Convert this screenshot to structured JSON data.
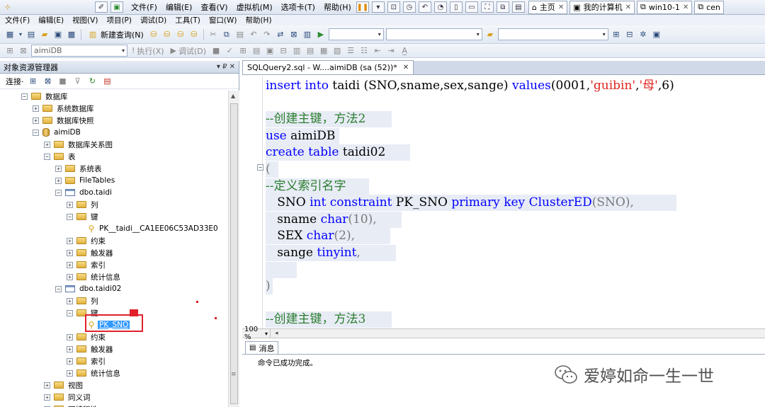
{
  "vm": {
    "menu": [
      "文件(F)",
      "编辑(E)",
      "查看(V)",
      "虚拟机(M)",
      "选项卡(T)",
      "帮助(H)"
    ],
    "tabs": [
      "主页",
      "我的计算机",
      "win10-1",
      "cen"
    ]
  },
  "ssms_menu": [
    "文件(F)",
    "编辑(E)",
    "视图(V)",
    "项目(P)",
    "调试(D)",
    "工具(T)",
    "窗口(W)",
    "帮助(H)"
  ],
  "toolbar1": {
    "new_query": "新建查询(N)"
  },
  "toolbar2": {
    "database": "aimiDB",
    "execute": "执行(X)",
    "debug": "调试(D)"
  },
  "explorer": {
    "title": "对象资源管理器",
    "pin": "▾ ₽ ✕",
    "connect": "连接·",
    "tree": [
      {
        "label": "数据库",
        "expander": "⊟",
        "icon": "folder"
      },
      {
        "label": "系统数据库",
        "expander": "⊞",
        "icon": "folder"
      },
      {
        "label": "数据库快照",
        "expander": "⊞",
        "icon": "folder"
      },
      {
        "label": "aimiDB",
        "expander": "⊟",
        "icon": "database"
      },
      {
        "label": "数据库关系图",
        "expander": "⊞",
        "icon": "folder"
      },
      {
        "label": "表",
        "expander": "⊟",
        "icon": "folder"
      },
      {
        "label": "系统表",
        "expander": "⊞",
        "icon": "folder"
      },
      {
        "label": "FileTables",
        "expander": "⊞",
        "icon": "folder"
      },
      {
        "label": "dbo.taidi",
        "expander": "⊟",
        "icon": "table"
      },
      {
        "label": "列",
        "expander": "⊞",
        "icon": "folder"
      },
      {
        "label": "键",
        "expander": "⊟",
        "icon": "folder"
      },
      {
        "label": "PK__taidi__CA1EE06C53AD33E0",
        "expander": "",
        "icon": "key"
      },
      {
        "label": "约束",
        "expander": "⊞",
        "icon": "folder"
      },
      {
        "label": "触发器",
        "expander": "⊞",
        "icon": "folder"
      },
      {
        "label": "索引",
        "expander": "⊞",
        "icon": "folder"
      },
      {
        "label": "统计信息",
        "expander": "⊞",
        "icon": "folder"
      },
      {
        "label": "dbo.taidi02",
        "expander": "⊟",
        "icon": "table"
      },
      {
        "label": "列",
        "expander": "⊞",
        "icon": "folder"
      },
      {
        "label": "键",
        "expander": "⊟",
        "icon": "folder"
      },
      {
        "label": "PK_SNO",
        "expander": "",
        "icon": "key"
      },
      {
        "label": "约束",
        "expander": "⊞",
        "icon": "folder"
      },
      {
        "label": "触发器",
        "expander": "⊞",
        "icon": "folder"
      },
      {
        "label": "索引",
        "expander": "⊞",
        "icon": "folder"
      },
      {
        "label": "统计信息",
        "expander": "⊞",
        "icon": "folder"
      },
      {
        "label": "视图",
        "expander": "⊞",
        "icon": "folder"
      },
      {
        "label": "同义词",
        "expander": "⊞",
        "icon": "folder"
      },
      {
        "label": "可编程性",
        "expander": "⊞",
        "icon": "folder"
      }
    ]
  },
  "editor": {
    "tab_label": "SQLQuery2.sql - W....aimiDB (sa (52))*",
    "code": [
      [
        [
          "insert into",
          "kw"
        ],
        [
          " taidi (SNO,sname,sex,sange) ",
          ""
        ],
        [
          "values",
          "kw"
        ],
        [
          "(0001,",
          ""
        ],
        [
          "'guibin'",
          "str"
        ],
        [
          ",",
          ""
        ],
        [
          "'母'",
          "str"
        ],
        [
          ",6)",
          ""
        ]
      ],
      [],
      [
        [
          "--创建主键，方法2",
          "cm"
        ]
      ],
      [
        [
          "use",
          "kw"
        ],
        [
          " aimiDB",
          ""
        ]
      ],
      [
        [
          "create table",
          "kw"
        ],
        [
          " taidi02",
          ""
        ]
      ],
      [
        [
          "(",
          "gray"
        ]
      ],
      [
        [
          "--定义索引名字",
          "cm"
        ]
      ],
      [
        [
          "   SNO ",
          ""
        ],
        [
          "int constraint",
          "kw"
        ],
        [
          " PK_SNO ",
          ""
        ],
        [
          "primary key",
          "kw"
        ],
        [
          " ",
          ""
        ],
        [
          "ClusterED",
          "kw"
        ],
        [
          "(SNO),",
          "gray"
        ]
      ],
      [
        [
          "   sname ",
          ""
        ],
        [
          "char",
          "kw"
        ],
        [
          "(10),",
          "gray"
        ]
      ],
      [
        [
          "   SEX ",
          ""
        ],
        [
          "char",
          "kw"
        ],
        [
          "(2),",
          "gray"
        ]
      ],
      [
        [
          "   sange ",
          ""
        ],
        [
          "tinyint",
          "kw"
        ],
        [
          ",",
          "gray"
        ]
      ],
      [
        [
          "   ",
          ""
        ]
      ],
      [
        [
          ")",
          "gray"
        ]
      ],
      [],
      [
        [
          "--创建主键，方法3",
          "cm"
        ]
      ]
    ],
    "zoom": "100 %",
    "results_tab": "消息",
    "results_message": "命令已成功完成。"
  },
  "watermark": "爱婷如命一生一世"
}
